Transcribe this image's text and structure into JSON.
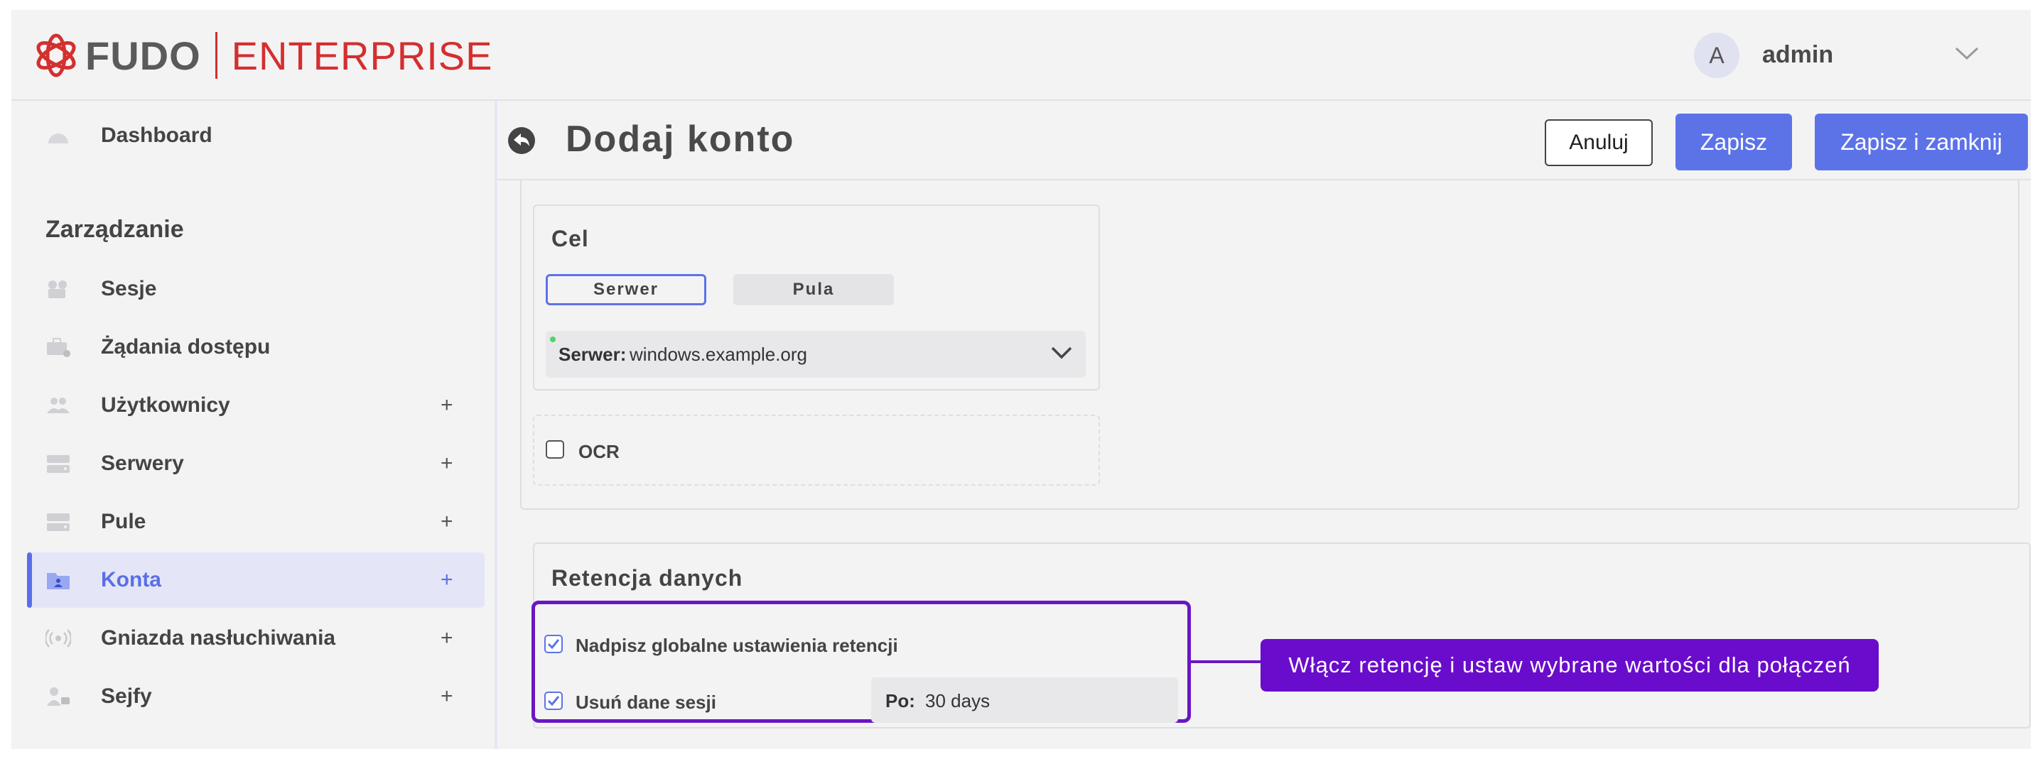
{
  "header": {
    "brand": "FUDO",
    "edition": "ENTERPRISE",
    "avatar_initial": "A",
    "username": "admin"
  },
  "sidebar": {
    "dashboard": "Dashboard",
    "section_title": "Zarządzanie",
    "items": [
      {
        "label": "Sesje",
        "icon": "camera-icon",
        "plus": ""
      },
      {
        "label": "Żądania dostępu",
        "icon": "briefcase-icon",
        "plus": ""
      },
      {
        "label": "Użytkownicy",
        "icon": "users-icon",
        "plus": "+"
      },
      {
        "label": "Serwery",
        "icon": "server-icon",
        "plus": "+"
      },
      {
        "label": "Pule",
        "icon": "server-icon",
        "plus": "+"
      },
      {
        "label": "Konta",
        "icon": "folder-user-icon",
        "plus": "+",
        "active": true
      },
      {
        "label": "Gniazda nasłuchiwania",
        "icon": "signal-icon",
        "plus": "+"
      },
      {
        "label": "Sejfy",
        "icon": "user-lock-icon",
        "plus": "+"
      }
    ]
  },
  "page": {
    "title": "Dodaj konto",
    "cancel": "Anuluj",
    "save": "Zapisz",
    "save_close": "Zapisz i zamknij"
  },
  "target": {
    "title": "Cel",
    "toggle_server": "Serwer",
    "toggle_pool": "Pula",
    "server_key": "Serwer:",
    "server_value": "windows.example.org"
  },
  "ocr": {
    "label": "OCR",
    "checked": false
  },
  "retention": {
    "title": "Retencja danych",
    "override_label": "Nadpisz globalne ustawienia retencji",
    "delete_label": "Usuń dane sesji",
    "after_key": "Po:",
    "after_value": "30 days"
  },
  "callout": {
    "text": "Włącz retencję i ustaw wybrane wartości dla połączeń"
  },
  "colors": {
    "accent": "#5c73e8",
    "brand_red": "#d42f2f",
    "callout": "#6a0ccc"
  }
}
